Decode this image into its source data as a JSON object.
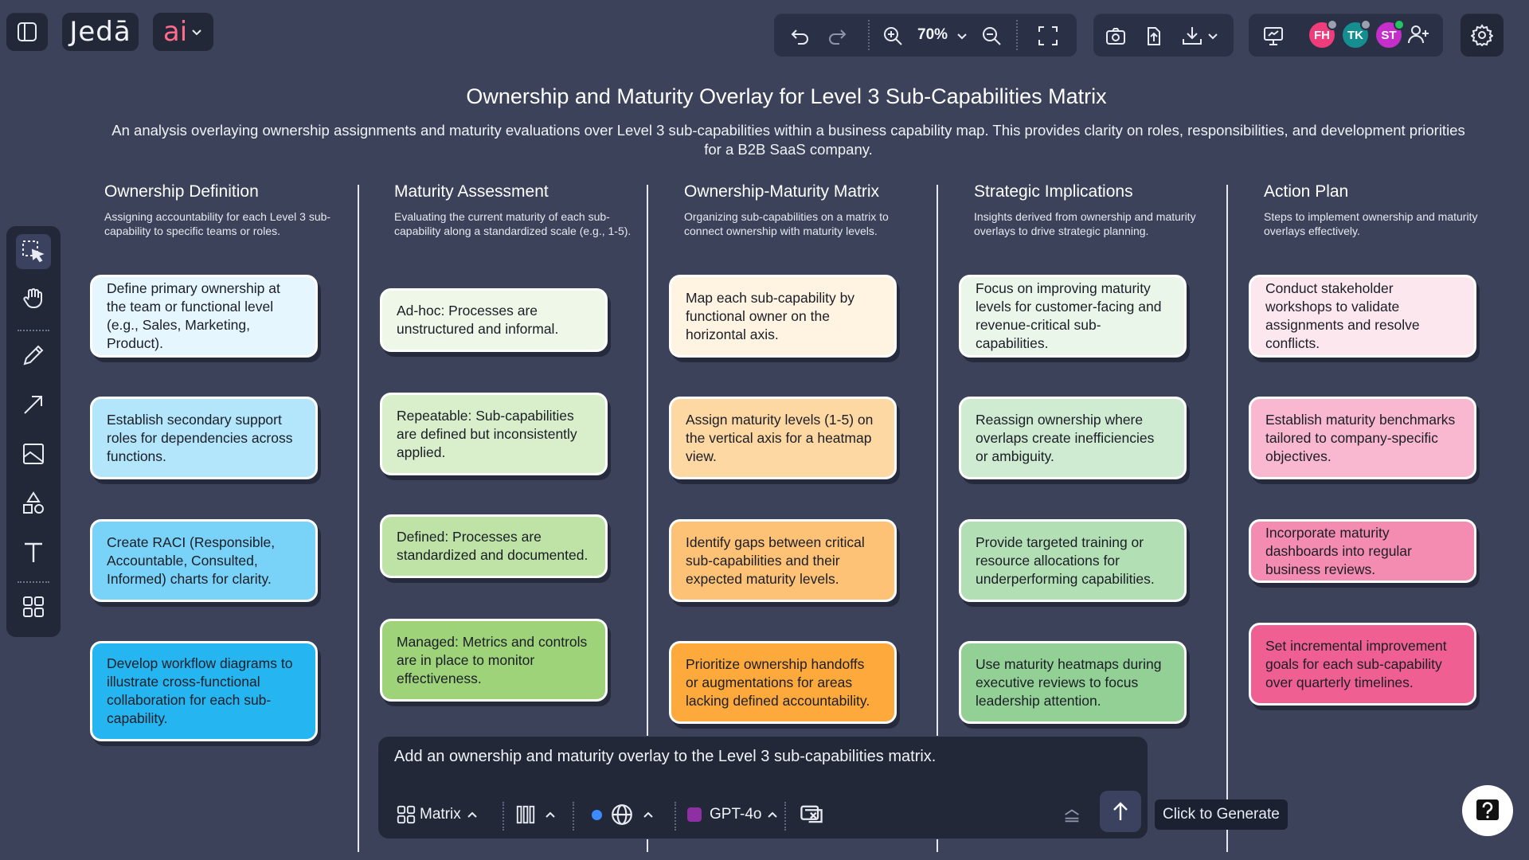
{
  "app": {
    "logo": "Jedā",
    "ai_label": "ai"
  },
  "toolbar": {
    "zoom": "70%"
  },
  "collaborators": [
    {
      "initials": "FH",
      "color": "#ef3d7b",
      "status": "#9aa0ae"
    },
    {
      "initials": "TK",
      "color": "#158e8f",
      "status": "#9aa0ae"
    },
    {
      "initials": "ST",
      "color": "#c42fc9",
      "status": "#22c55e"
    }
  ],
  "document": {
    "title": "Ownership and Maturity Overlay for Level 3 Sub-Capabilities Matrix",
    "description": "An analysis overlaying ownership assignments and maturity evaluations over Level 3 sub-capabilities within a business capability map. This provides clarity on roles, responsibilities, and development priorities for a B2B SaaS company."
  },
  "columns": [
    {
      "title": "Ownership Definition",
      "subtitle": "Assigning accountability for each Level 3 sub-capability to specific teams or roles.",
      "cards": [
        {
          "text": "Define primary ownership at the team or functional level (e.g., Sales, Marketing, Product).",
          "color": "#e6f6fe"
        },
        {
          "text": "Establish secondary support roles for dependencies across functions.",
          "color": "#b3e6fb"
        },
        {
          "text": "Create RACI (Responsible, Accountable, Consulted, Informed) charts for clarity.",
          "color": "#79d2f8"
        },
        {
          "text": "Develop workflow diagrams to illustrate cross-functional collaboration for each sub-capability.",
          "color": "#25b6f1"
        }
      ]
    },
    {
      "title": "Maturity Assessment",
      "subtitle": "Evaluating the current maturity of each sub-capability along a standardized scale (e.g., 1-5).",
      "cards": [
        {
          "text": "Ad-hoc: Processes are unstructured and informal.",
          "color": "#eef7e8"
        },
        {
          "text": "Repeatable: Sub-capabilities are defined but inconsistently applied.",
          "color": "#d9efcc"
        },
        {
          "text": "Defined: Processes are standardized and documented.",
          "color": "#bfe3a6"
        },
        {
          "text": "Managed: Metrics and controls are in place to monitor effectiveness.",
          "color": "#9ed37a"
        }
      ]
    },
    {
      "title": "Ownership-Maturity Matrix",
      "subtitle": "Organizing sub-capabilities on a matrix to connect ownership with maturity levels.",
      "cards": [
        {
          "text": "Map each sub-capability by functional owner on the horizontal axis.",
          "color": "#fff3e2"
        },
        {
          "text": "Assign maturity levels (1-5) on the vertical axis for a heatmap view.",
          "color": "#fed8a2"
        },
        {
          "text": "Identify gaps between critical sub-capabilities and their expected maturity levels.",
          "color": "#fec277"
        },
        {
          "text": "Prioritize ownership handoffs or augmentations for areas lacking defined accountability.",
          "color": "#fea93b"
        }
      ]
    },
    {
      "title": "Strategic Implications",
      "subtitle": "Insights derived from ownership and maturity overlays to drive strategic planning.",
      "cards": [
        {
          "text": "Focus on improving maturity levels for customer-facing and revenue-critical sub-capabilities.",
          "color": "#ebf6ea"
        },
        {
          "text": "Reassign ownership where overlaps create inefficiencies or ambiguity.",
          "color": "#cfebd1"
        },
        {
          "text": "Provide targeted training or resource allocations for underperforming capabilities.",
          "color": "#b3dfb5"
        },
        {
          "text": "Use maturity heatmaps during executive reviews to focus leadership attention.",
          "color": "#93d095"
        }
      ]
    },
    {
      "title": "Action Plan",
      "subtitle": "Steps to implement ownership and maturity overlays effectively.",
      "cards": [
        {
          "text": "Conduct stakeholder workshops to validate assignments and resolve conflicts.",
          "color": "#fde7ef"
        },
        {
          "text": "Establish maturity benchmarks tailored to company-specific objectives.",
          "color": "#f9b8cf"
        },
        {
          "text": "Incorporate maturity dashboards into regular business reviews.",
          "color": "#f48bb0"
        },
        {
          "text": "Set incremental improvement goals for each sub-capability over quarterly timelines.",
          "color": "#ef5f92"
        }
      ]
    }
  ],
  "prompt": {
    "text": "Add an ownership and maturity overlay to the Level 3 sub-capabilities matrix.",
    "diagram_type": "Matrix",
    "model": "GPT-4o",
    "tooltip": "Click to Generate"
  }
}
